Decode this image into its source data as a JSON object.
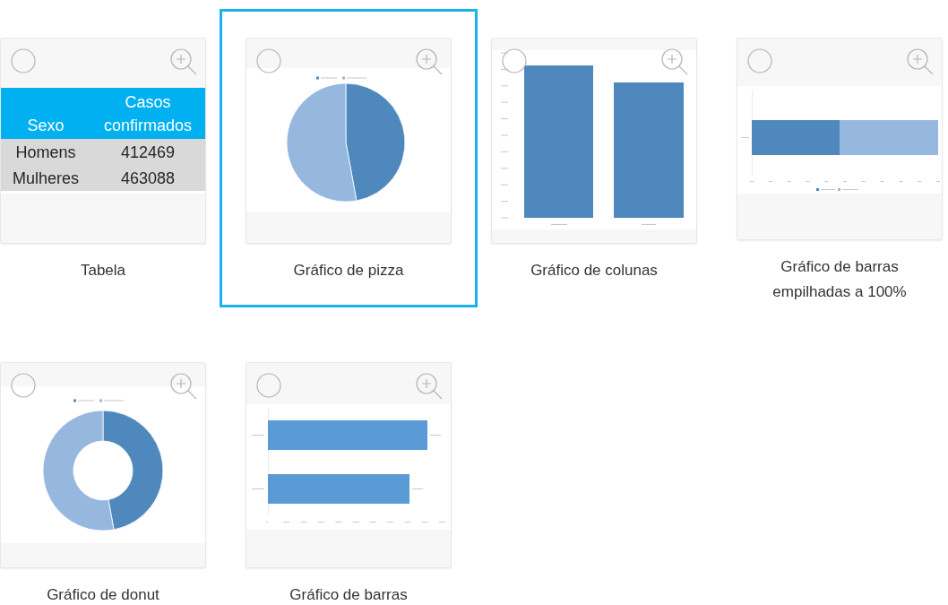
{
  "items": [
    {
      "label": "Tabela",
      "selected": false,
      "thumbnail": {
        "kind": "table",
        "columns": [
          "Sexo",
          "Casos confirmados"
        ],
        "rows": [
          [
            "Homens",
            "412469"
          ],
          [
            "Mulheres",
            "463088"
          ]
        ]
      }
    },
    {
      "label": "Gráfico de pizza",
      "selected": true,
      "thumbnail": {
        "kind": "pie"
      }
    },
    {
      "label": "Gráfico de colunas",
      "selected": false,
      "thumbnail": {
        "kind": "column"
      }
    },
    {
      "label": "Gráfico de barras empilhadas a 100%",
      "selected": false,
      "thumbnail": {
        "kind": "stacked"
      }
    },
    {
      "label": "Gráfico de donut",
      "selected": false,
      "thumbnail": {
        "kind": "donut"
      }
    },
    {
      "label": "Gráfico de barras",
      "selected": false,
      "thumbnail": {
        "kind": "bar"
      }
    }
  ]
}
